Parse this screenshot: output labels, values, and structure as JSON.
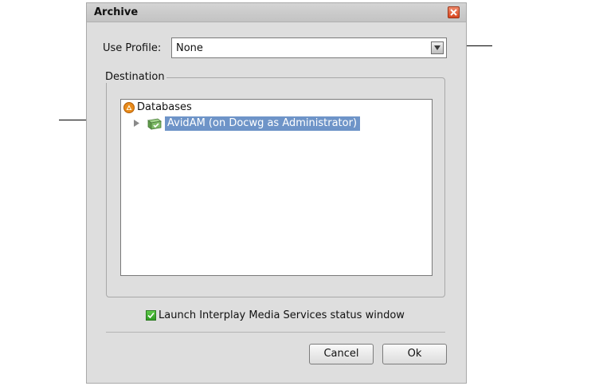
{
  "dialog": {
    "title": "Archive",
    "close_icon": "close-icon"
  },
  "profile": {
    "label": "Use Profile:",
    "value": "None",
    "dropdown_icon": "chevron-down-icon"
  },
  "destination": {
    "group_label": "Destination",
    "tree": {
      "root_label": "Databases",
      "root_icon": "database-icon",
      "children": [
        {
          "label": "AvidAM (on Docwg as Administrator)",
          "icon": "server-icon",
          "expand_icon": "expand-triangle-icon",
          "selected": true
        }
      ]
    }
  },
  "launch_status": {
    "label": "Launch Interplay Media Services status window",
    "checked": true
  },
  "buttons": {
    "cancel": "Cancel",
    "ok": "Ok"
  },
  "colors": {
    "selection": "#6e94c8",
    "dialog_bg": "#dedede",
    "close_button": "#d8461f",
    "checkbox": "#2f9b22"
  }
}
